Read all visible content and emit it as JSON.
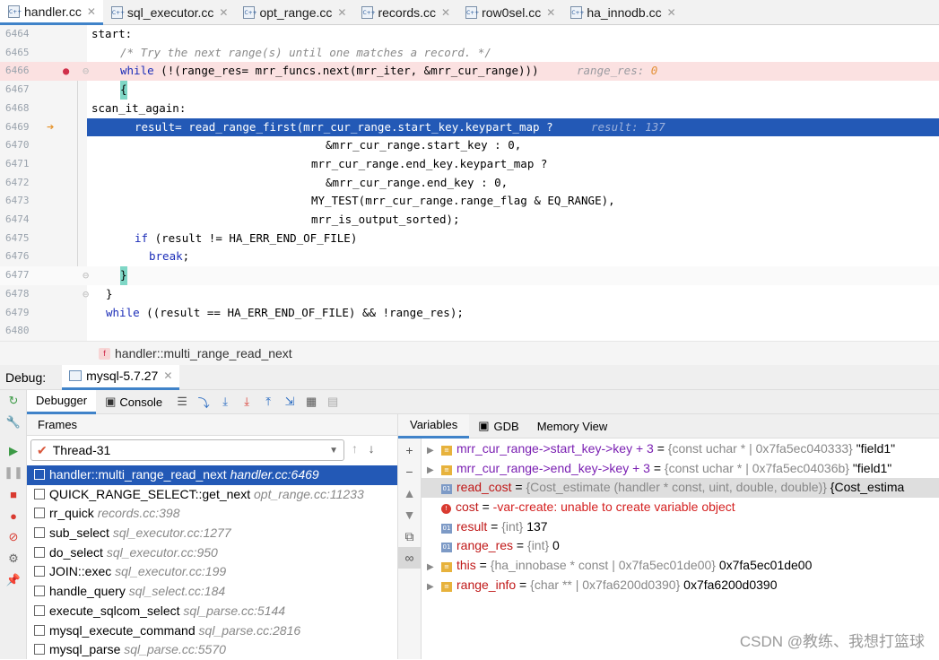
{
  "tabs": [
    {
      "label": "handler.cc",
      "active": true
    },
    {
      "label": "sql_executor.cc"
    },
    {
      "label": "opt_range.cc"
    },
    {
      "label": "records.cc"
    },
    {
      "label": "row0sel.cc"
    },
    {
      "label": "ha_innodb.cc"
    }
  ],
  "file_icon": "C++",
  "editor": {
    "lines": [
      {
        "num": "6464"
      },
      {
        "num": "6465"
      },
      {
        "num": "6466"
      },
      {
        "num": "6467"
      },
      {
        "num": "6468"
      },
      {
        "num": "6469"
      },
      {
        "num": "6470"
      },
      {
        "num": "6471"
      },
      {
        "num": "6472"
      },
      {
        "num": "6473"
      },
      {
        "num": "6474"
      },
      {
        "num": "6475"
      },
      {
        "num": "6476"
      },
      {
        "num": "6477"
      },
      {
        "num": "6478"
      },
      {
        "num": "6479"
      },
      {
        "num": "6480"
      }
    ],
    "code": {
      "l6464": "start:",
      "l6465": "/* Try the next range(s) until one matches a record. */",
      "l6466_kw": "while",
      "l6466": " (!(range_res= mrr_funcs.next(mrr_iter, &mrr_cur_range)))",
      "l6466_hint": "range_res: ",
      "l6466_hint_val": "0",
      "l6467": "{",
      "l6468": "scan_it_again:",
      "l6469": "result= read_range_first(mrr_cur_range.start_key.keypart_map ?",
      "l6469_hint": "result: 137",
      "l6470": "&mrr_cur_range.start_key : 0,",
      "l6471": "mrr_cur_range.end_key.keypart_map ?",
      "l6472": "&mrr_cur_range.end_key : 0,",
      "l6473": "MY_TEST(mrr_cur_range.range_flag & EQ_RANGE),",
      "l6474": "mrr_is_output_sorted);",
      "l6475_kw": "if",
      "l6475": " (result != HA_ERR_END_OF_FILE)",
      "l6476_kw": "break",
      "l6476": ";",
      "l6477": "}",
      "l6478": "}",
      "l6479_kw": "while",
      "l6479": " ((result == HA_ERR_END_OF_FILE) && !range_res);"
    }
  },
  "breadcrumb": {
    "icon": "f",
    "label": "handler::multi_range_read_next"
  },
  "debug": {
    "label": "Debug:",
    "session": "mysql-5.7.27",
    "tabs": {
      "debugger": "Debugger",
      "console": "Console"
    },
    "frames_label": "Frames",
    "thread": "Thread-31",
    "frames": [
      {
        "fn": "handler::multi_range_read_next",
        "loc": "handler.cc:6469",
        "selected": true
      },
      {
        "fn": "QUICK_RANGE_SELECT::get_next",
        "loc": "opt_range.cc:11233"
      },
      {
        "fn": "rr_quick",
        "loc": "records.cc:398"
      },
      {
        "fn": "sub_select",
        "loc": "sql_executor.cc:1277"
      },
      {
        "fn": "do_select",
        "loc": "sql_executor.cc:950"
      },
      {
        "fn": "JOIN::exec",
        "loc": "sql_executor.cc:199"
      },
      {
        "fn": "handle_query",
        "loc": "sql_select.cc:184"
      },
      {
        "fn": "execute_sqlcom_select",
        "loc": "sql_parse.cc:5144"
      },
      {
        "fn": "mysql_execute_command",
        "loc": "sql_parse.cc:2816"
      },
      {
        "fn": "mysql_parse",
        "loc": "sql_parse.cc:5570"
      }
    ],
    "var_tabs": {
      "variables": "Variables",
      "gdb": "GDB",
      "memory": "Memory View"
    },
    "variables": [
      {
        "name": "mrr_cur_range->start_key->key + 3",
        "type": "{const uchar * | 0x7fa5ec040333}",
        "value": "\"field1\"",
        "icon": "stack",
        "expand": true
      },
      {
        "name": "mrr_cur_range->end_key->key + 3",
        "type": "{const uchar * | 0x7fa5ec04036b}",
        "value": "\"field1\"",
        "icon": "stack",
        "expand": true
      },
      {
        "name": "read_cost",
        "type": "{Cost_estimate (handler * const, uint, double, double)}",
        "value": "{Cost_estima",
        "icon": "01",
        "highlight": true
      },
      {
        "name": "cost",
        "type": "",
        "value": "-var-create: unable to create variable object",
        "icon": "err",
        "error": true
      },
      {
        "name": "result",
        "type": "{int}",
        "value": "137",
        "icon": "01"
      },
      {
        "name": "range_res",
        "type": "{int}",
        "value": "0",
        "icon": "01"
      },
      {
        "name": "this",
        "type": "{ha_innobase * const | 0x7fa5ec01de00}",
        "value": "0x7fa5ec01de00",
        "icon": "stack",
        "expand": true
      },
      {
        "name": "range_info",
        "type": "{char ** | 0x7fa6200d0390}",
        "value": "0x7fa6200d0390",
        "icon": "stack",
        "expand": true
      }
    ]
  },
  "watermark": "CSDN @教练、我想打篮球"
}
